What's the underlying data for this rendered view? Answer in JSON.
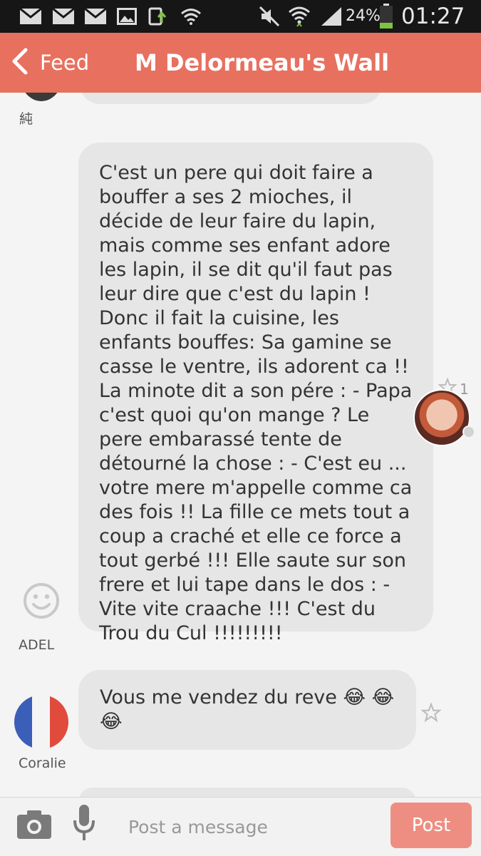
{
  "status_bar": {
    "battery": "24%",
    "time": "01:27",
    "icons": [
      "mail-icon",
      "mail-icon",
      "mail-icon",
      "image-icon",
      "download-icon",
      "wifi-icon",
      "mute-icon",
      "wifi-icon",
      "signal-icon",
      "battery-icon"
    ]
  },
  "header": {
    "back_label": "Feed",
    "title": "M Delormeau's Wall",
    "color": "#e8705f"
  },
  "feed": {
    "posts": [
      {
        "author": "純",
        "text": ""
      },
      {
        "author": "ADEL",
        "text": "C'est un pere qui doit faire a bouffer a ses 2 mioches, il décide de leur faire du lapin, mais comme ses enfant adore les lapin, il se dit qu'il faut pas leur dire que c'est du lapin ! Donc il fait la cuisine, les enfants bouffes: Sa gamine se casse le ventre, ils adorent ca !! La minote dit a son pére : - Papa c'est quoi qu'on mange ?  Le pere embarassé tente de détourné la chose : - C'est eu ... votre mere m'appelle comme ca des fois !! La fille ce mets tout a coup a craché et elle ce force a tout gerbé !!! Elle saute sur son frere et lui tape dans le dos : - Vite vite craache !!! C'est du Trou du Cul !!!!!!!!!",
        "star_count": "1",
        "starred": true
      },
      {
        "author": "Coralie",
        "text": "Vous me vendez du reve 😂 😂 😂",
        "starred": false
      }
    ]
  },
  "composer": {
    "placeholder": "Post a message",
    "post_label": "Post",
    "post_color": "#ee8e82"
  }
}
